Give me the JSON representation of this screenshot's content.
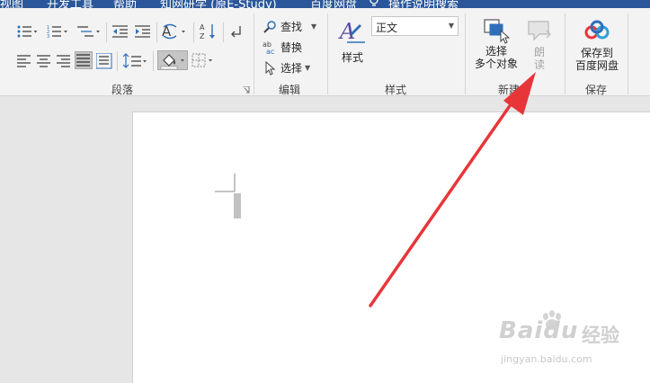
{
  "tabs": [
    "视图",
    "开发工具",
    "帮助",
    "知网研学 (原E-Study)",
    "百度网盘",
    "操作说明搜索"
  ],
  "paragraph": {
    "label": "段落"
  },
  "editing": {
    "label": "编辑",
    "find": "查找",
    "replace": "替换",
    "select": "选择"
  },
  "styles": {
    "label": "样式",
    "button": "样式",
    "current": "正文"
  },
  "new_group": {
    "label": "新建组",
    "select_btn_line1": "选择",
    "select_btn_line2": "多个对象",
    "read_line1": "朗",
    "read_line2": "读"
  },
  "save": {
    "label": "保存",
    "line1": "保存到",
    "line2": "百度网盘"
  },
  "watermark": {
    "logo": "Baidu",
    "cn": "经验",
    "url": "jingyan.baidu.com"
  },
  "colors": {
    "ribbon": "#f3f3f3",
    "tabbar": "#2b579a",
    "arrow": "#e8353a",
    "page": "#ffffff",
    "workspace": "#e6e6e6"
  }
}
